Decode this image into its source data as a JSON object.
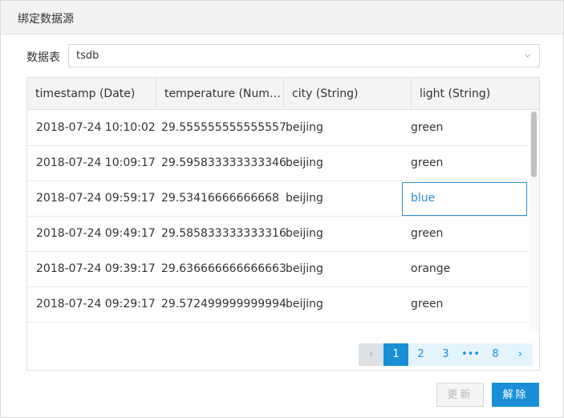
{
  "dialog": {
    "title": "绑定数据源"
  },
  "datasource": {
    "label": "数据表",
    "selected": "tsdb"
  },
  "table": {
    "columns": [
      "timestamp (Date)",
      "temperature (Num…",
      "city (String)",
      "light (String)"
    ],
    "rows": [
      [
        "2018-07-24 10:10:02",
        "29.555555555555557",
        "beijing",
        "green"
      ],
      [
        "2018-07-24 10:09:17",
        "29.595833333333346",
        "beijing",
        "green"
      ],
      [
        "2018-07-24 09:59:17",
        "29.53416666666668",
        "beijing",
        "blue"
      ],
      [
        "2018-07-24 09:49:17",
        "29.585833333333316",
        "beijing",
        "green"
      ],
      [
        "2018-07-24 09:39:17",
        "29.636666666666663",
        "beijing",
        "orange"
      ],
      [
        "2018-07-24 09:29:17",
        "29.572499999999994",
        "beijing",
        "green"
      ]
    ],
    "selected_cell": {
      "row": 2,
      "col": 3
    }
  },
  "pagination": {
    "prev": "‹",
    "pages": [
      "1",
      "2",
      "3"
    ],
    "ellipsis": "•••",
    "last": "8",
    "next": "›",
    "current": "1"
  },
  "buttons": {
    "update": "更新",
    "unbind": "解除"
  },
  "colors": {
    "accent": "#1a8fd8",
    "header_bg": "#f4f4f4",
    "selected_border": "#2d8ed4"
  },
  "icons": {
    "select_arrow": "chevron-down-icon",
    "prev": "chevron-left-icon",
    "next": "chevron-right-icon"
  }
}
